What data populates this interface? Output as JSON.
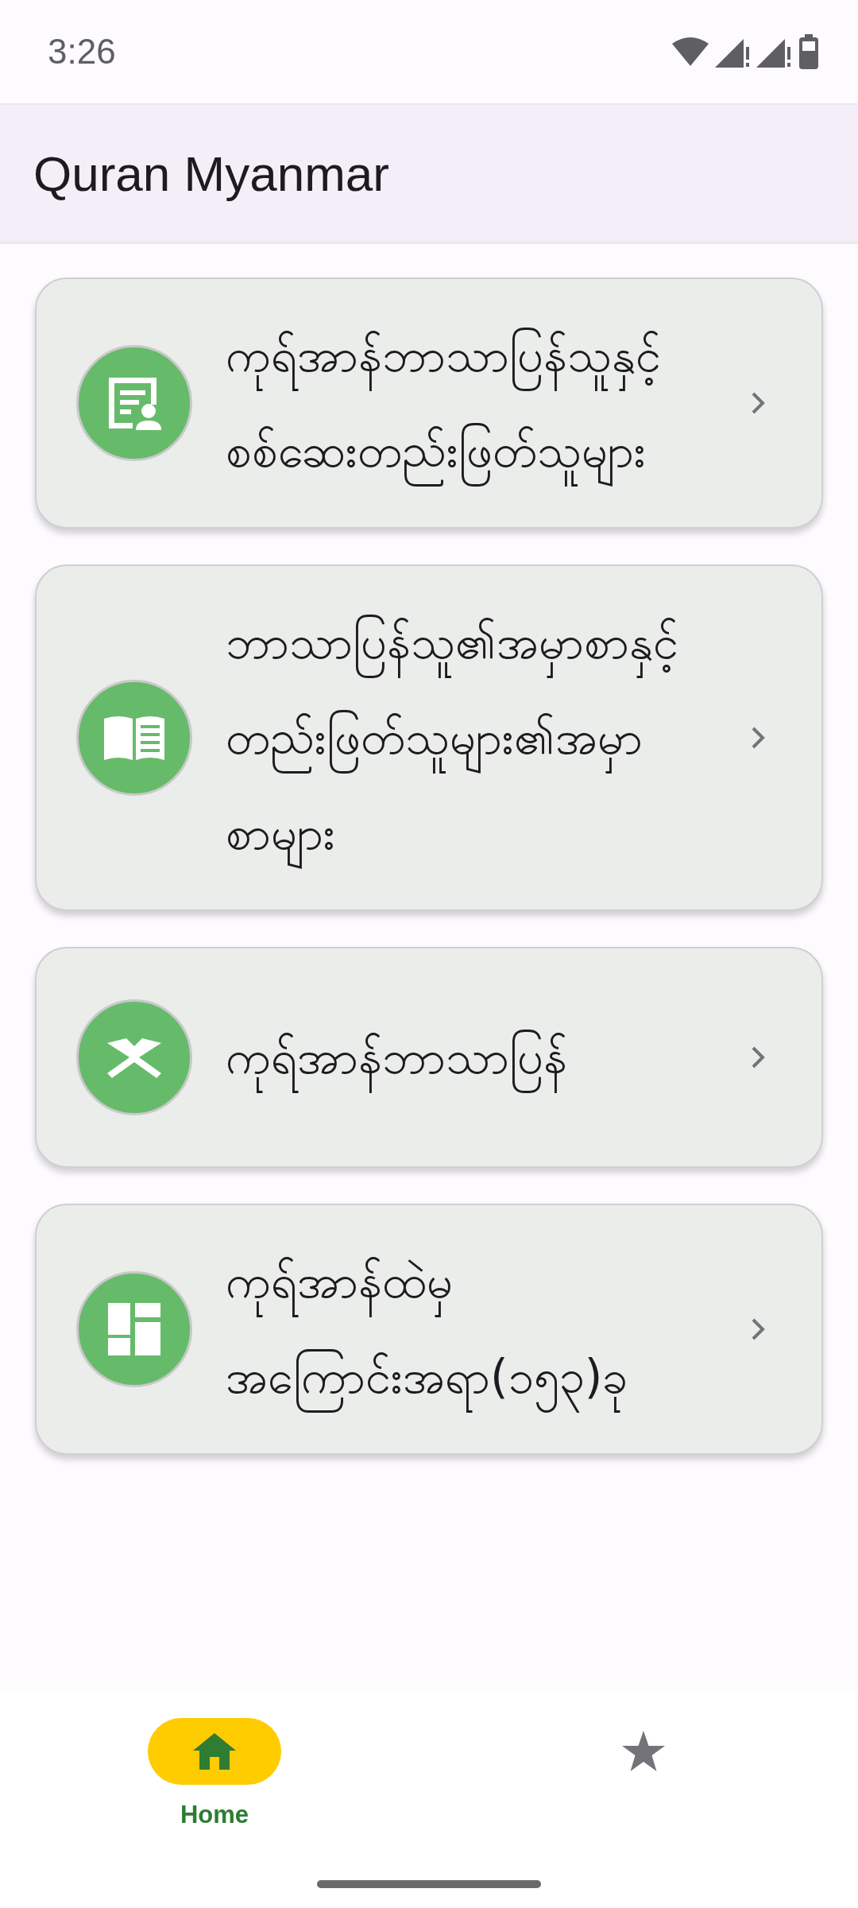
{
  "status_bar": {
    "time": "3:26"
  },
  "app_bar": {
    "title": "Quran Myanmar"
  },
  "menu": [
    {
      "lines": [
        "ကုရ်အာန်ဘာသာပြန်သူနှင့်",
        "စစ်ဆေးတည်းဖြတ်သူများ"
      ]
    },
    {
      "lines": [
        "ဘာသာပြန်သူ၏အမှာစာနှင့်",
        "တည်းဖြတ်သူများ၏အမှာ",
        "စာများ"
      ]
    },
    {
      "lines": [
        "ကုရ်အာန်ဘာသာပြန်"
      ]
    },
    {
      "lines": [
        "ကုရ်အာန်ထဲမှ",
        "အကြောင်းအရာ(၁၅၃)ခု"
      ]
    }
  ],
  "bottom_nav": [
    {
      "label": "Home",
      "selected": true
    },
    {
      "selected": false
    }
  ]
}
